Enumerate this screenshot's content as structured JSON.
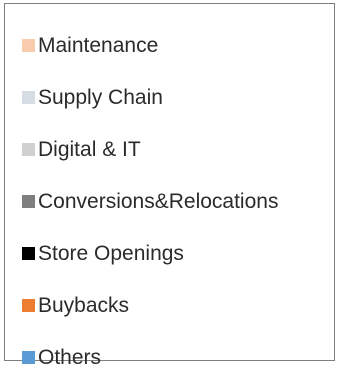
{
  "chart_data": {
    "type": "legend",
    "legend": {
      "entries": [
        {
          "name": "Maintenance",
          "color": "#f8cbad"
        },
        {
          "name": "Supply Chain",
          "color": "#d6dce4"
        },
        {
          "name": "Digital & IT",
          "color": "#d0d0d0"
        },
        {
          "name": "Conversions&Relocations",
          "color": "#7f7f7f"
        },
        {
          "name": "Store Openings",
          "color": "#000000"
        },
        {
          "name": "Buybacks",
          "color": "#ed7d31"
        },
        {
          "name": "Others",
          "color": "#5b9bd5"
        }
      ]
    }
  }
}
